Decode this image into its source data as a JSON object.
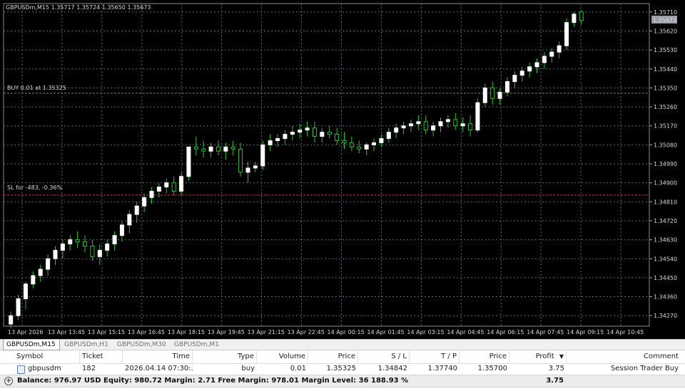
{
  "chart": {
    "header_text": "GBPUSDm,M15  1.35717 1.35724 1.35650 1.35673",
    "current_price_label": "1.35673",
    "order_label": "BUY 0.01 at 1.35325",
    "sl_label": "SL for -483, -0.36%",
    "price_ticks": [
      "1.35710",
      "1.35620",
      "1.35530",
      "1.35440",
      "1.35350",
      "1.35260",
      "1.35170",
      "1.35080",
      "1.34990",
      "1.34900",
      "1.34810",
      "1.34720",
      "1.34630",
      "1.34540",
      "1.34450",
      "1.34360",
      "1.34270"
    ],
    "time_ticks": [
      "13 Apr 2026",
      "13 Apr 13:45",
      "13 Apr 15:15",
      "13 Apr 16:45",
      "13 Apr 18:15",
      "13 Apr 19:45",
      "13 Apr 21:15",
      "13 Apr 22:45",
      "14 Apr 00:15",
      "14 Apr 01:45",
      "14 Apr 03:15",
      "14 Apr 04:45",
      "14 Apr 06:15",
      "14 Apr 07:45",
      "14 Apr 09:15",
      "14 Apr 10:45"
    ],
    "colors": {
      "background": "#000000",
      "grid": "#5a6a72",
      "bull": "#ffffff",
      "bear": "#ffffff",
      "wick": "#2fbf2f",
      "order_line": "#7a7a7a",
      "sl_line": "#c23b3b"
    }
  },
  "chart_data": {
    "type": "candlestick",
    "symbol": "GBPUSDm",
    "timeframe": "M15",
    "ylim": [
      1.3422,
      1.3575
    ],
    "order_price": 1.35325,
    "sl_price": 1.34842,
    "candles": [
      [
        1.3423,
        1.3429,
        1.3421,
        1.3427
      ],
      [
        1.3427,
        1.3437,
        1.3425,
        1.3435
      ],
      [
        1.3435,
        1.3443,
        1.343,
        1.3442
      ],
      [
        1.3442,
        1.3448,
        1.344,
        1.3446
      ],
      [
        1.3446,
        1.3451,
        1.3443,
        1.3449
      ],
      [
        1.3449,
        1.3456,
        1.3446,
        1.3454
      ],
      [
        1.3454,
        1.346,
        1.3451,
        1.3458
      ],
      [
        1.3458,
        1.3463,
        1.3454,
        1.3461
      ],
      [
        1.3461,
        1.3465,
        1.3458,
        1.3463
      ],
      [
        1.3463,
        1.3467,
        1.3459,
        1.3462
      ],
      [
        1.3462,
        1.3465,
        1.3457,
        1.346
      ],
      [
        1.346,
        1.3463,
        1.3453,
        1.3455
      ],
      [
        1.3455,
        1.3461,
        1.3451,
        1.3458
      ],
      [
        1.3458,
        1.3463,
        1.3455,
        1.3461
      ],
      [
        1.3461,
        1.3467,
        1.3458,
        1.3465
      ],
      [
        1.3465,
        1.3472,
        1.3462,
        1.347
      ],
      [
        1.347,
        1.3477,
        1.3466,
        1.3475
      ],
      [
        1.3475,
        1.3481,
        1.3471,
        1.3479
      ],
      [
        1.3479,
        1.3485,
        1.3476,
        1.3483
      ],
      [
        1.3483,
        1.3488,
        1.348,
        1.3486
      ],
      [
        1.3486,
        1.349,
        1.3483,
        1.3488
      ],
      [
        1.3488,
        1.3492,
        1.3485,
        1.349
      ],
      [
        1.349,
        1.3493,
        1.3484,
        1.3486
      ],
      [
        1.3486,
        1.3495,
        1.3484,
        1.3493
      ],
      [
        1.3493,
        1.3503,
        1.3491,
        1.3507
      ],
      [
        1.3507,
        1.3512,
        1.3503,
        1.3506
      ],
      [
        1.3506,
        1.351,
        1.3502,
        1.3505
      ],
      [
        1.3505,
        1.3509,
        1.3502,
        1.3507
      ],
      [
        1.3507,
        1.351,
        1.3503,
        1.3505
      ],
      [
        1.3505,
        1.3509,
        1.3501,
        1.3507
      ],
      [
        1.3507,
        1.351,
        1.3503,
        1.3506
      ],
      [
        1.3506,
        1.3509,
        1.3493,
        1.3495
      ],
      [
        1.3495,
        1.35,
        1.349,
        1.3497
      ],
      [
        1.3497,
        1.35,
        1.3495,
        1.3498
      ],
      [
        1.3498,
        1.351,
        1.3496,
        1.3508
      ],
      [
        1.3508,
        1.3513,
        1.3505,
        1.351
      ],
      [
        1.351,
        1.3513,
        1.3507,
        1.3511
      ],
      [
        1.3511,
        1.3515,
        1.3508,
        1.3513
      ],
      [
        1.3513,
        1.3517,
        1.351,
        1.3514
      ],
      [
        1.3514,
        1.3518,
        1.3511,
        1.3515
      ],
      [
        1.3515,
        1.3519,
        1.3512,
        1.3516
      ],
      [
        1.3516,
        1.3519,
        1.3509,
        1.3512
      ],
      [
        1.3512,
        1.3516,
        1.3509,
        1.3514
      ],
      [
        1.3514,
        1.3517,
        1.3511,
        1.3513
      ],
      [
        1.3513,
        1.3516,
        1.3508,
        1.351
      ],
      [
        1.351,
        1.3514,
        1.3506,
        1.3509
      ],
      [
        1.3509,
        1.3512,
        1.3505,
        1.3507
      ],
      [
        1.3507,
        1.351,
        1.3504,
        1.3506
      ],
      [
        1.3506,
        1.3509,
        1.3503,
        1.3508
      ],
      [
        1.3508,
        1.3511,
        1.3505,
        1.3509
      ],
      [
        1.3509,
        1.3513,
        1.3507,
        1.3511
      ],
      [
        1.3511,
        1.3516,
        1.3509,
        1.3514
      ],
      [
        1.3514,
        1.3518,
        1.3511,
        1.3516
      ],
      [
        1.3516,
        1.3519,
        1.3513,
        1.3517
      ],
      [
        1.3517,
        1.352,
        1.3514,
        1.3518
      ],
      [
        1.3518,
        1.3522,
        1.3515,
        1.3519
      ],
      [
        1.3519,
        1.3522,
        1.3513,
        1.3515
      ],
      [
        1.3515,
        1.3519,
        1.3512,
        1.3517
      ],
      [
        1.3517,
        1.3521,
        1.3514,
        1.3519
      ],
      [
        1.3519,
        1.3522,
        1.3516,
        1.352
      ],
      [
        1.352,
        1.3523,
        1.3515,
        1.3517
      ],
      [
        1.3517,
        1.3521,
        1.3514,
        1.3518
      ],
      [
        1.3518,
        1.3522,
        1.3512,
        1.3515
      ],
      [
        1.3515,
        1.353,
        1.3514,
        1.3528
      ],
      [
        1.3528,
        1.3537,
        1.3526,
        1.3535
      ],
      [
        1.3535,
        1.3538,
        1.3527,
        1.353
      ],
      [
        1.353,
        1.3535,
        1.3527,
        1.3533
      ],
      [
        1.3533,
        1.354,
        1.3531,
        1.3538
      ],
      [
        1.3538,
        1.3543,
        1.3535,
        1.3541
      ],
      [
        1.3541,
        1.3545,
        1.3538,
        1.3543
      ],
      [
        1.3543,
        1.3547,
        1.354,
        1.3545
      ],
      [
        1.3545,
        1.3549,
        1.3542,
        1.3547
      ],
      [
        1.3547,
        1.3552,
        1.3544,
        1.355
      ],
      [
        1.355,
        1.3554,
        1.3547,
        1.3552
      ],
      [
        1.3552,
        1.3557,
        1.3549,
        1.3555
      ],
      [
        1.3555,
        1.3568,
        1.3553,
        1.3566
      ],
      [
        1.3566,
        1.3571,
        1.3564,
        1.357
      ],
      [
        1.3571,
        1.3572,
        1.3565,
        1.3567
      ]
    ]
  },
  "tabs": [
    {
      "label": "GBPUSDm,M15",
      "active": true
    },
    {
      "label": "GBPUSDm,H1",
      "active": false
    },
    {
      "label": "GBPUSDm,M30",
      "active": false
    },
    {
      "label": "GBPUSDm,M1",
      "active": false
    }
  ],
  "trade_table": {
    "columns": [
      "Symbol",
      "Ticket",
      "Time",
      "Type",
      "Volume",
      "Price",
      "S / L",
      "T / P",
      "Price",
      "Profit",
      "Comment"
    ],
    "sort_indicator": "▼",
    "row": {
      "symbol": "gbpusdm",
      "ticket": "182",
      "time": "2026.04.14 07:30:...",
      "type": "buy",
      "volume": "0.01",
      "price": "1.35325",
      "sl": "1.34842",
      "tp": "1.37740",
      "current_price": "1.35700",
      "profit": "3.75",
      "comment": "Session Trader Buy"
    },
    "balance_line": "Balance: 976.97 USD  Equity: 980.72  Margin: 2.71  Free Margin: 978.01  Margin Level: 36 188.93 %",
    "balance_profit": "3.75"
  }
}
